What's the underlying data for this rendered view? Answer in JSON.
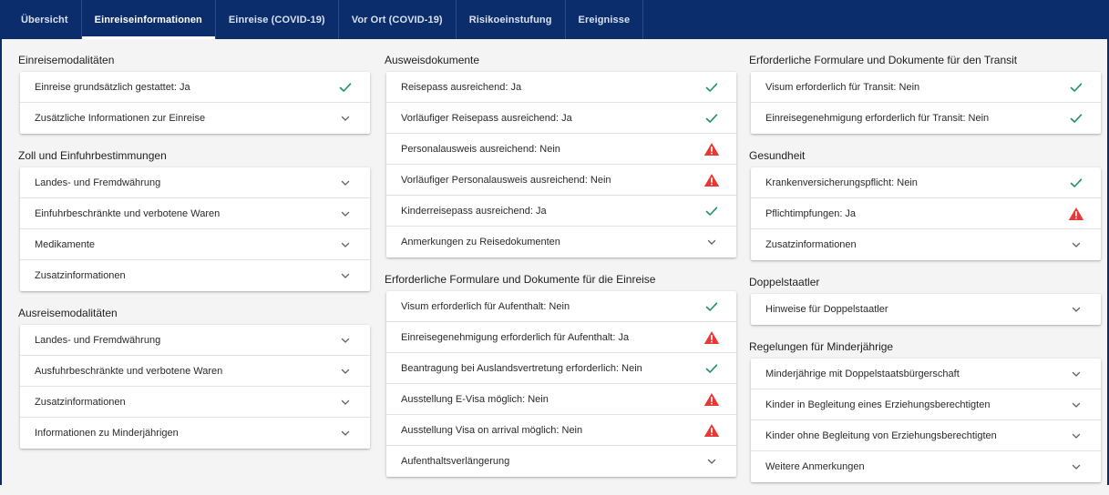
{
  "tabs": [
    {
      "label": "Übersicht",
      "active": false
    },
    {
      "label": "Einreiseinformationen",
      "active": true
    },
    {
      "label": "Einreise (COVID-19)",
      "active": false
    },
    {
      "label": "Vor Ort (COVID-19)",
      "active": false
    },
    {
      "label": "Risikoeinstufung",
      "active": false
    },
    {
      "label": "Ereignisse",
      "active": false
    }
  ],
  "colors": {
    "nav_bg": "#0c2d6b",
    "check": "#1f8f6f",
    "warning": "#e53935",
    "chevron": "#5f6368"
  },
  "columns": [
    {
      "sections": [
        {
          "title": "Einreisemodalitäten",
          "rows": [
            {
              "label": "Einreise grundsätzlich gestattet: Ja",
              "icon": "check-icon"
            },
            {
              "label": "Zusätzliche Informationen zur Einreise",
              "icon": "chevron-down-icon"
            }
          ]
        },
        {
          "title": "Zoll und Einfuhrbestimmungen",
          "rows": [
            {
              "label": "Landes- und Fremdwährung",
              "icon": "chevron-down-icon"
            },
            {
              "label": "Einfuhrbeschränkte und verbotene Waren",
              "icon": "chevron-down-icon"
            },
            {
              "label": "Medikamente",
              "icon": "chevron-down-icon"
            },
            {
              "label": "Zusatzinformationen",
              "icon": "chevron-down-icon"
            }
          ]
        },
        {
          "title": "Ausreisemodalitäten",
          "rows": [
            {
              "label": "Landes- und Fremdwährung",
              "icon": "chevron-down-icon"
            },
            {
              "label": "Ausfuhrbeschränkte und verbotene Waren",
              "icon": "chevron-down-icon"
            },
            {
              "label": "Zusatzinformationen",
              "icon": "chevron-down-icon"
            },
            {
              "label": "Informationen zu Minderjährigen",
              "icon": "chevron-down-icon"
            }
          ]
        }
      ]
    },
    {
      "sections": [
        {
          "title": "Ausweisdokumente",
          "rows": [
            {
              "label": "Reisepass ausreichend: Ja",
              "icon": "check-icon"
            },
            {
              "label": "Vorläufiger Reisepass ausreichend: Ja",
              "icon": "check-icon"
            },
            {
              "label": "Personalausweis ausreichend: Nein",
              "icon": "warning-icon"
            },
            {
              "label": "Vorläufiger Personalausweis ausreichend: Nein",
              "icon": "warning-icon"
            },
            {
              "label": "Kinderreisepass ausreichend: Ja",
              "icon": "check-icon"
            },
            {
              "label": "Anmerkungen zu Reisedokumenten",
              "icon": "chevron-down-icon"
            }
          ]
        },
        {
          "title": "Erforderliche Formulare und Dokumente für die Einreise",
          "rows": [
            {
              "label": "Visum erforderlich für Aufenthalt: Nein",
              "icon": "check-icon"
            },
            {
              "label": "Einreisegenehmigung erforderlich für Aufenthalt: Ja",
              "icon": "warning-icon"
            },
            {
              "label": "Beantragung bei Auslandsvertretung erforderlich: Nein",
              "icon": "check-icon"
            },
            {
              "label": "Ausstellung E-Visa möglich: Nein",
              "icon": "warning-icon"
            },
            {
              "label": "Ausstellung Visa on arrival möglich: Nein",
              "icon": "warning-icon"
            },
            {
              "label": "Aufenthaltsverlängerung",
              "icon": "chevron-down-icon"
            }
          ]
        }
      ]
    },
    {
      "sections": [
        {
          "title": "Erforderliche Formulare und Dokumente für den Transit",
          "rows": [
            {
              "label": "Visum erforderlich für Transit: Nein",
              "icon": "check-icon"
            },
            {
              "label": "Einreisegenehmigung erforderlich für Transit: Nein",
              "icon": "check-icon"
            }
          ]
        },
        {
          "title": "Gesundheit",
          "rows": [
            {
              "label": "Krankenversicherungspflicht: Nein",
              "icon": "check-icon"
            },
            {
              "label": "Pflichtimpfungen: Ja",
              "icon": "warning-icon"
            },
            {
              "label": "Zusatzinformationen",
              "icon": "chevron-down-icon"
            }
          ]
        },
        {
          "title": "Doppelstaatler",
          "rows": [
            {
              "label": "Hinweise für Doppelstaatler",
              "icon": "chevron-down-icon"
            }
          ]
        },
        {
          "title": "Regelungen für Minderjährige",
          "rows": [
            {
              "label": "Minderjährige mit Doppelstaatsbürgerschaft",
              "icon": "chevron-down-icon"
            },
            {
              "label": "Kinder in Begleitung eines Erziehungsberechtigten",
              "icon": "chevron-down-icon"
            },
            {
              "label": "Kinder ohne Begleitung von Erziehungsberechtigten",
              "icon": "chevron-down-icon"
            },
            {
              "label": "Weitere Anmerkungen",
              "icon": "chevron-down-icon"
            }
          ]
        }
      ]
    }
  ]
}
